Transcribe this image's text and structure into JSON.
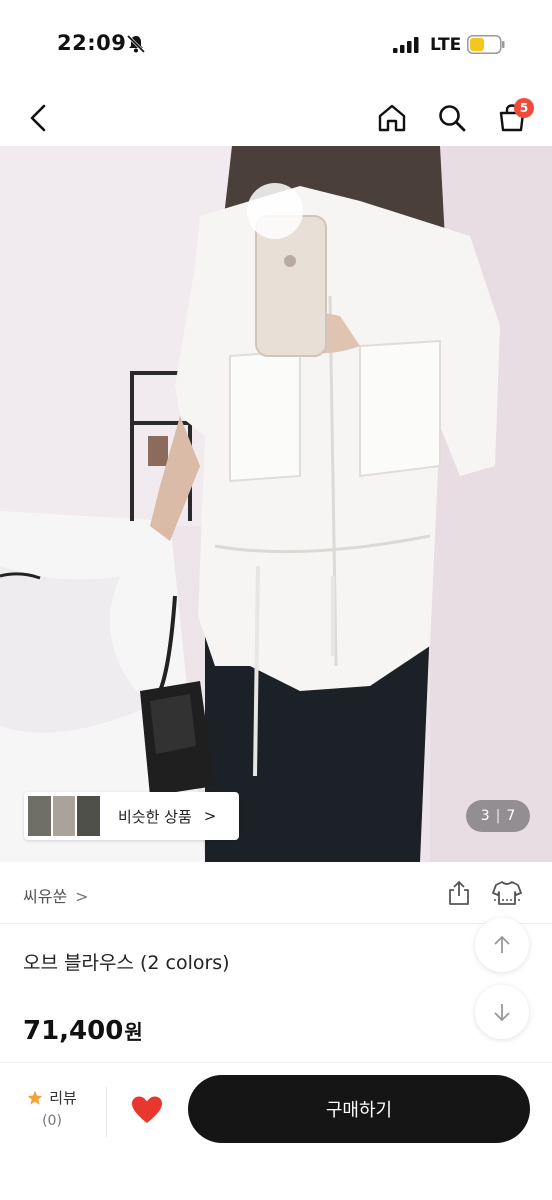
{
  "status_bar": {
    "time": "22:09",
    "network": "LTE"
  },
  "header": {
    "cart_badge": "5",
    "icons": [
      "back-icon",
      "home-icon",
      "search-icon",
      "cart-icon"
    ]
  },
  "gallery": {
    "similar_label": "비슷한 상품",
    "similar_chevron": ">",
    "current_page": "3",
    "separator": "|",
    "total_pages": "7"
  },
  "store": {
    "name": "씨유쑨",
    "chevron": ">"
  },
  "product": {
    "title": "오브 블라우스 (2 colors)",
    "price": "71,400",
    "currency": "원"
  },
  "bottom_bar": {
    "review_label": "리뷰",
    "review_count": "(0)",
    "buy_label": "구매하기"
  },
  "colors": {
    "badge": "#f04b3a",
    "heart": "#e8382e",
    "star": "#f3a33a",
    "buy_button": "#151515",
    "battery": "#f2c81f"
  }
}
